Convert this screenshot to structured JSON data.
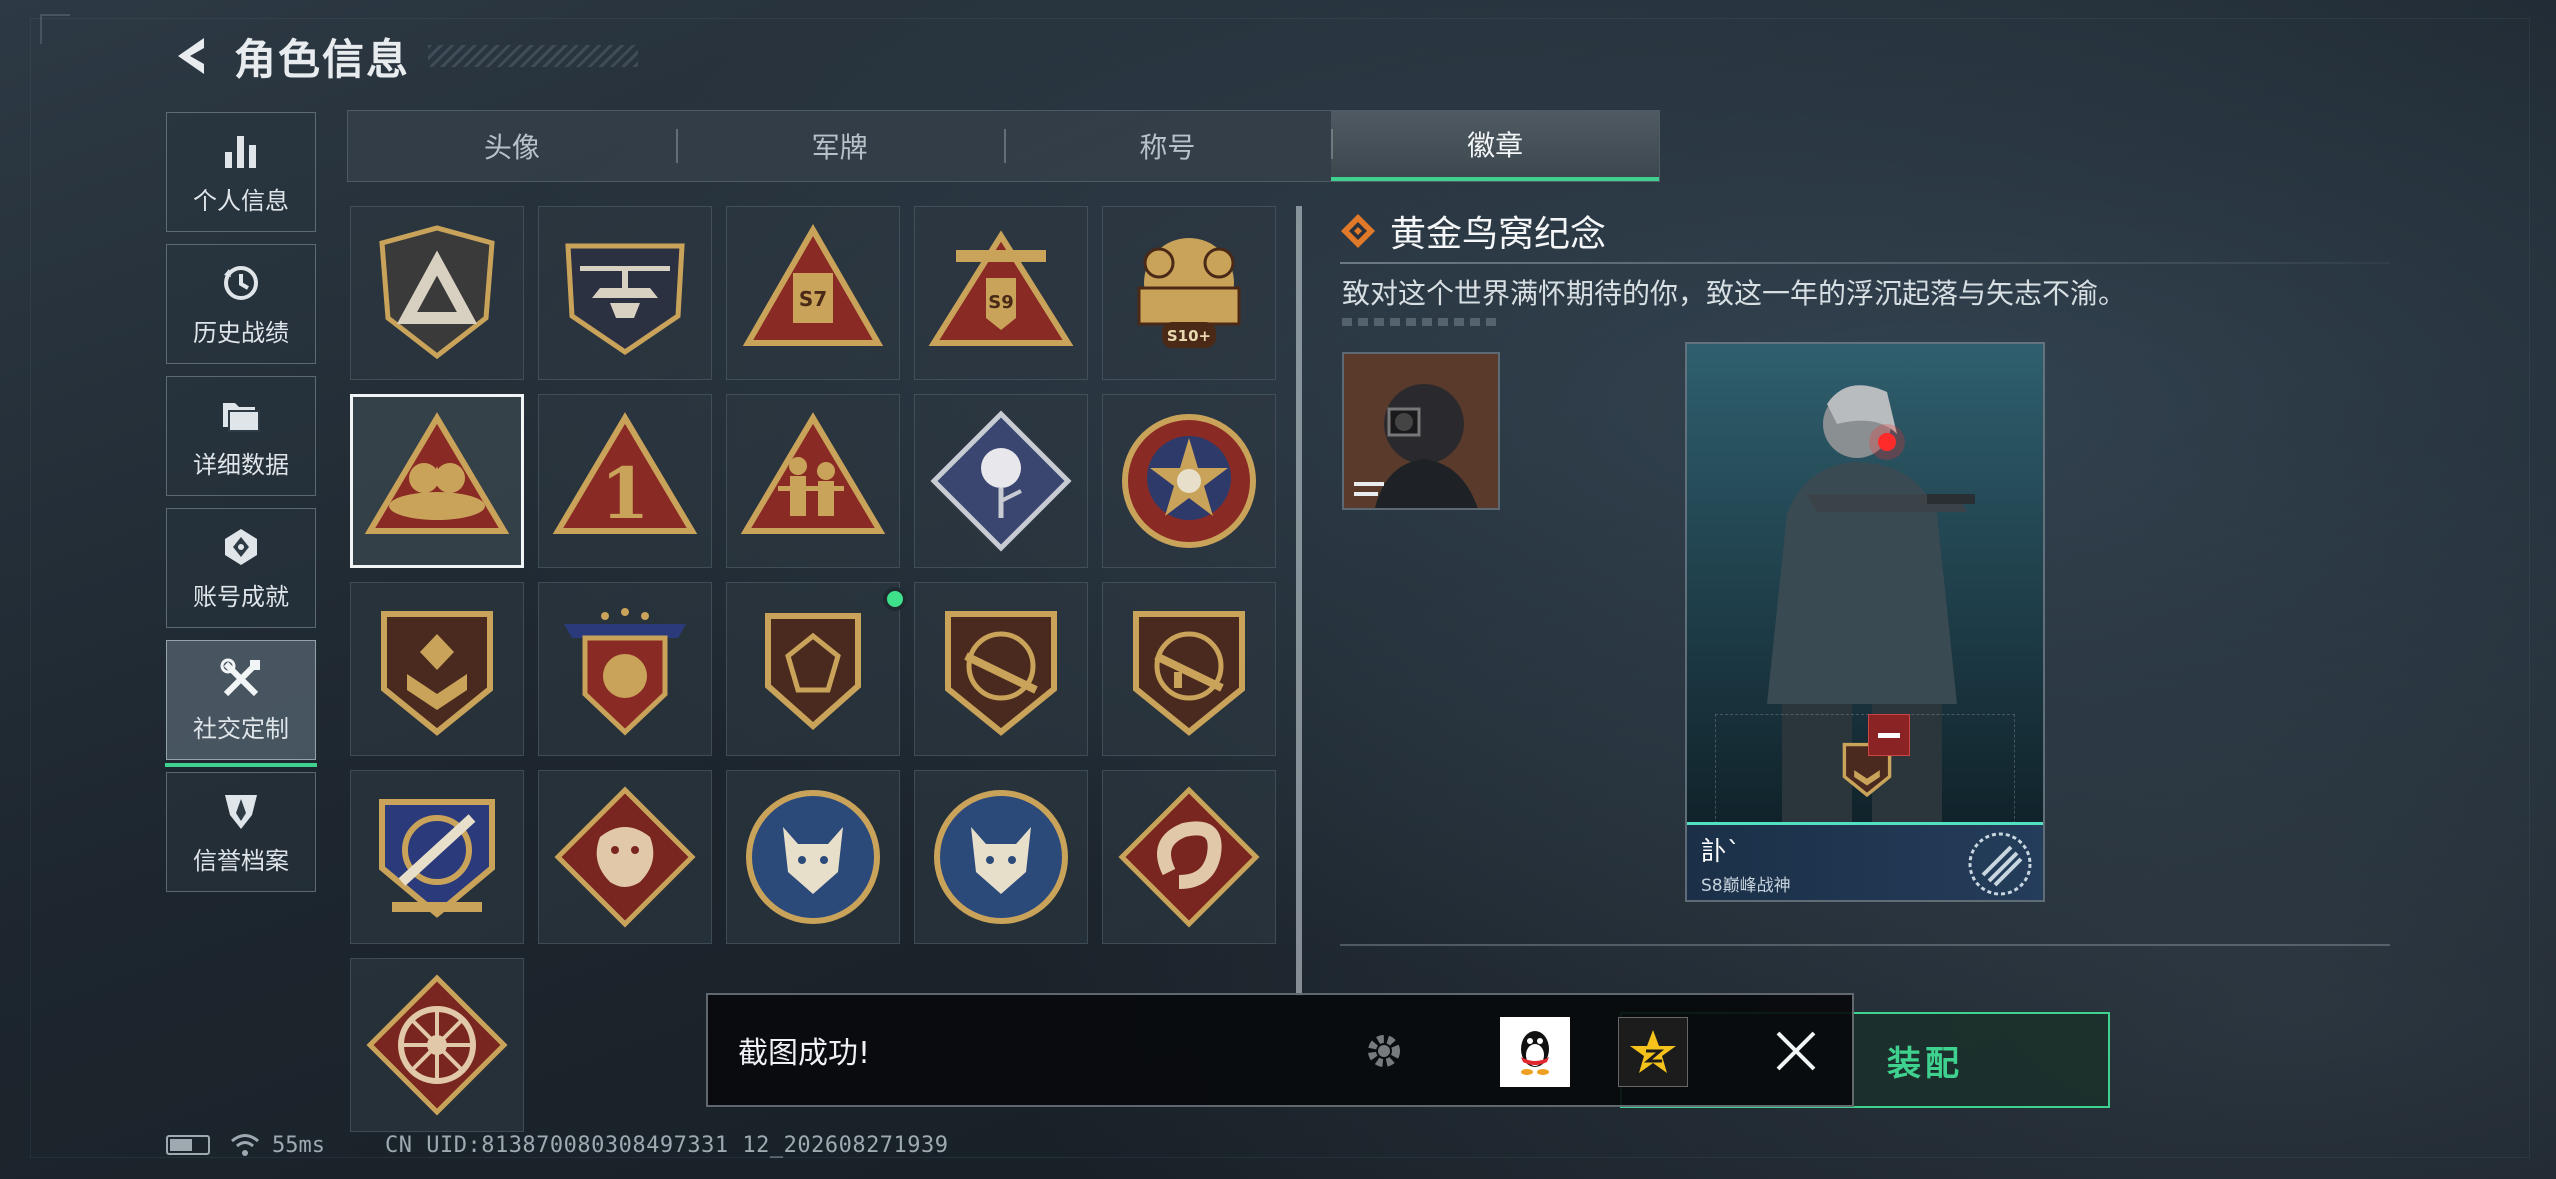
{
  "header": {
    "title": "角色信息"
  },
  "side_nav": [
    {
      "label": "个人信息",
      "icon": "bar-chart-icon"
    },
    {
      "label": "历史战绩",
      "icon": "history-clock-icon"
    },
    {
      "label": "详细数据",
      "icon": "folder-icon"
    },
    {
      "label": "账号成就",
      "icon": "achievement-icon"
    },
    {
      "label": "社交定制",
      "icon": "tools-icon",
      "active": true
    },
    {
      "label": "信誉档案",
      "icon": "reputation-shield-icon"
    }
  ],
  "tabs": [
    {
      "label": "头像"
    },
    {
      "label": "军牌"
    },
    {
      "label": "称号"
    },
    {
      "label": "徽章",
      "active": true
    }
  ],
  "badges": [
    {
      "icon": "triangle-shield-badge-icon"
    },
    {
      "icon": "helicopter-badge-icon"
    },
    {
      "icon": "season-s7-badge-icon",
      "text": "S7"
    },
    {
      "icon": "season-s9-badge-icon",
      "text": "S9"
    },
    {
      "icon": "season-s10-plus-badge-icon",
      "text": "S10+"
    },
    {
      "icon": "golden-nest-badge-icon",
      "selected": true
    },
    {
      "icon": "number-one-triangle-badge-icon",
      "text": "1"
    },
    {
      "icon": "soldiers-triangle-badge-icon"
    },
    {
      "icon": "rose-diamond-badge-icon"
    },
    {
      "icon": "star-skull-circle-badge-icon"
    },
    {
      "icon": "chevron-shield-badge-icon"
    },
    {
      "icon": "winged-star-shield-badge-icon"
    },
    {
      "icon": "gem-shield-badge-icon",
      "new": true
    },
    {
      "icon": "rifle-shield-badge-icon"
    },
    {
      "icon": "smg-shield-badge-icon"
    },
    {
      "icon": "crosshair-knife-badge-icon"
    },
    {
      "icon": "dragon-diamond-badge-icon"
    },
    {
      "icon": "wolf-circle-badge-icon"
    },
    {
      "icon": "wolf-circle-badge-icon-2"
    },
    {
      "icon": "serpent-diamond-badge-icon"
    },
    {
      "icon": "wheel-diamond-badge-icon"
    }
  ],
  "detail": {
    "name": "黄金鸟窝纪念",
    "description": "致对这个世界满怀期待的你，致这一年的浮沉起落与矢志不渝。"
  },
  "card": {
    "player_name": "訃`",
    "player_title": "S8巅峰战神"
  },
  "equip_button": {
    "label": "装配"
  },
  "toast": {
    "message": "截图成功!"
  },
  "status": {
    "ping": "55ms",
    "uid": "CN UID:813870080308497331 12_202608271939"
  },
  "colors": {
    "accent": "#3fd28f",
    "badge_gold": "#c9a35a",
    "badge_red": "#8a2a24"
  }
}
